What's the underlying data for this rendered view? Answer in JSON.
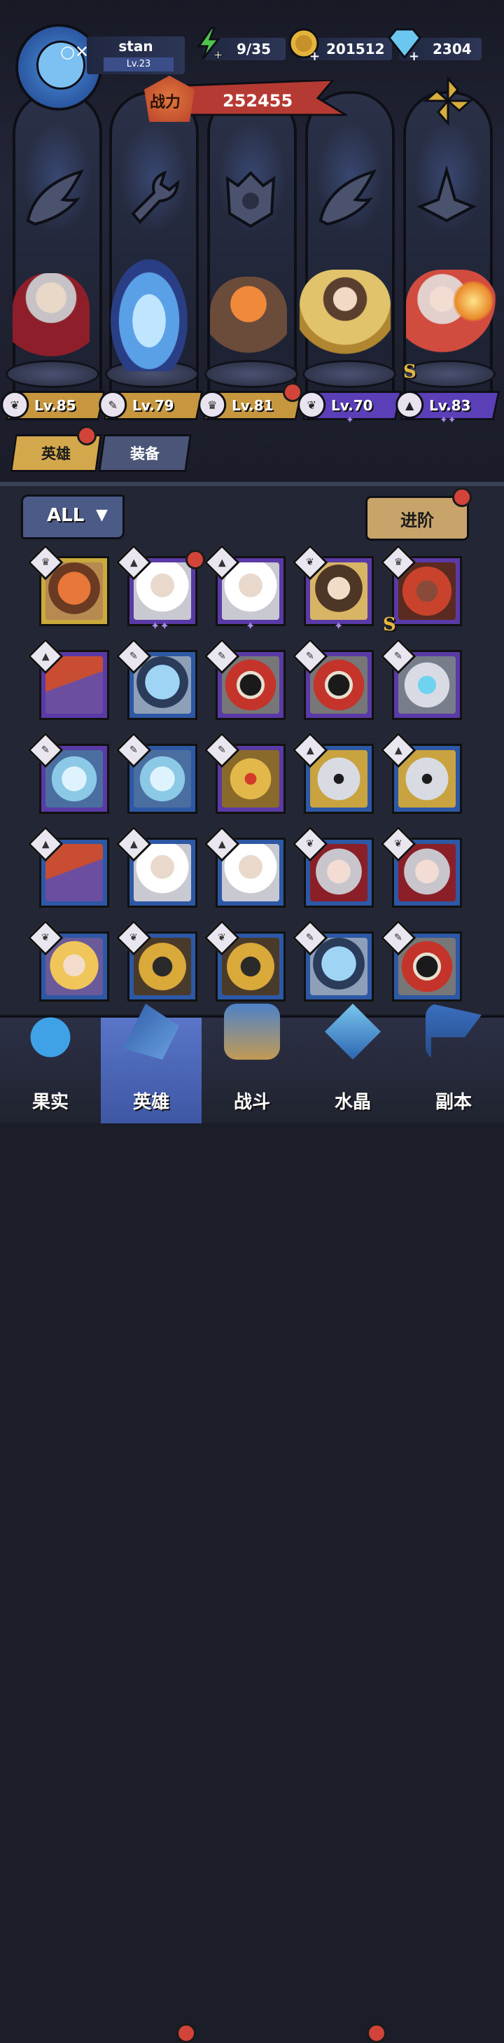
{
  "player": {
    "name": "stan",
    "level": "Lv.23"
  },
  "resources": {
    "energy": "9/35",
    "gold": "201512",
    "gems": "2304"
  },
  "power": {
    "label": "战力",
    "value": "252455"
  },
  "team": [
    {
      "level": "Lv.85",
      "badge": "gold",
      "icon": "wing-icon"
    },
    {
      "level": "Lv.79",
      "badge": "gold",
      "icon": "wrench-icon"
    },
    {
      "level": "Lv.81",
      "badge": "gold",
      "icon": "beast-icon"
    },
    {
      "level": "Lv.70",
      "badge": "purple",
      "icon": "wing-icon"
    },
    {
      "level": "Lv.83",
      "badge": "purple",
      "icon": "wizard-hat-icon"
    }
  ],
  "tabs": {
    "heroes": "英雄",
    "equipment": "装备"
  },
  "filter": {
    "label": "ALL"
  },
  "advance_button": "进阶",
  "roster": [
    {
      "frame": "gold",
      "cls": "beast",
      "portrait": "fox-warrior"
    },
    {
      "frame": "purple",
      "cls": "hat",
      "portrait": "old-sage",
      "dot": true,
      "stars": 2
    },
    {
      "frame": "purple",
      "cls": "hat",
      "portrait": "old-sage",
      "stars": 1
    },
    {
      "frame": "purple",
      "cls": "wing",
      "portrait": "goddess",
      "stars": 1
    },
    {
      "frame": "purple",
      "cls": "beast",
      "portrait": "red-lion",
      "rank": "S"
    },
    {
      "frame": "purple",
      "cls": "hat",
      "portrait": "hooded-mage"
    },
    {
      "frame": "blue",
      "cls": "wrench",
      "portrait": "fishbowl-robot"
    },
    {
      "frame": "purple",
      "cls": "wrench",
      "portrait": "bomb-bot"
    },
    {
      "frame": "purple",
      "cls": "wrench",
      "portrait": "bomb-bot"
    },
    {
      "frame": "purple",
      "cls": "wrench",
      "portrait": "chest-mimic"
    },
    {
      "frame": "purple",
      "cls": "wrench",
      "portrait": "glass-spirit"
    },
    {
      "frame": "blue",
      "cls": "wrench",
      "portrait": "glass-spirit"
    },
    {
      "frame": "purple",
      "cls": "wrench",
      "portrait": "gold-golem"
    },
    {
      "frame": "blue",
      "cls": "hat",
      "portrait": "knight-helm"
    },
    {
      "frame": "blue",
      "cls": "hat",
      "portrait": "knight-helm"
    },
    {
      "frame": "blue",
      "cls": "hat",
      "portrait": "hooded-mage"
    },
    {
      "frame": "blue",
      "cls": "hat",
      "portrait": "old-sage"
    },
    {
      "frame": "blue",
      "cls": "hat",
      "portrait": "old-sage"
    },
    {
      "frame": "blue",
      "cls": "wing",
      "portrait": "vampire-lady"
    },
    {
      "frame": "blue",
      "cls": "wing",
      "portrait": "vampire-lady"
    },
    {
      "frame": "blue",
      "cls": "wing",
      "portrait": "blonde-priestess"
    },
    {
      "frame": "blue",
      "cls": "wing",
      "portrait": "masked-pharaoh"
    },
    {
      "frame": "blue",
      "cls": "wing",
      "portrait": "masked-pharaoh"
    },
    {
      "frame": "blue",
      "cls": "wrench",
      "portrait": "fishbowl-robot"
    },
    {
      "frame": "blue",
      "cls": "wrench",
      "portrait": "bomb-bot"
    }
  ],
  "nav": [
    {
      "label": "果实",
      "icon": "fruit-icon"
    },
    {
      "label": "英雄",
      "icon": "hero-hat-icon",
      "active": true
    },
    {
      "label": "战斗",
      "icon": "battle-icon"
    },
    {
      "label": "水晶",
      "icon": "crystal-icon"
    },
    {
      "label": "副本",
      "icon": "flag-icon"
    }
  ],
  "colors": {
    "gold_frame": "#c9aa3c",
    "purple_frame": "#5a3aa6",
    "blue_frame": "#2d58a5",
    "red_dot": "#d2443a",
    "power_banner": "#b53a33",
    "nav_active": "#4d66b8"
  }
}
